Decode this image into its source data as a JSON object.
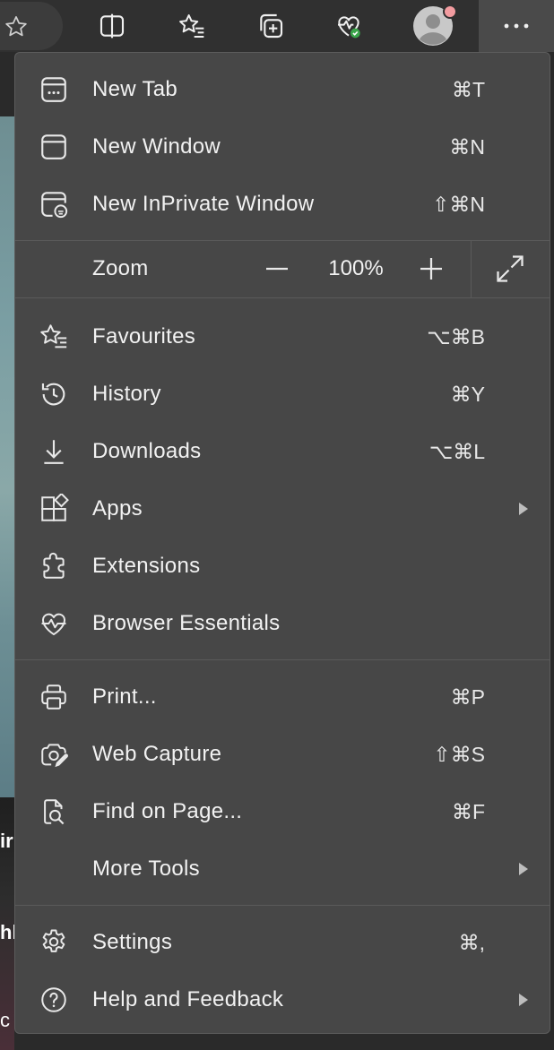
{
  "toolbar": {
    "icons": [
      "favorite-star-icon",
      "split-screen-icon",
      "favorites-icon",
      "collections-icon",
      "browser-essentials-icon",
      "profile-avatar-icon",
      "more-icon"
    ]
  },
  "background": {
    "peek_text_1": "ir",
    "peek_text_2": "hl",
    "peek_text_3": "c"
  },
  "menu": {
    "items": [
      {
        "label": "New Tab",
        "shortcut": "⌘T",
        "icon": "new-tab-icon"
      },
      {
        "label": "New Window",
        "shortcut": "⌘N",
        "icon": "new-window-icon"
      },
      {
        "label": "New InPrivate Window",
        "shortcut": "⇧⌘N",
        "icon": "inprivate-icon"
      },
      {
        "label": "Favourites",
        "shortcut": "⌥⌘B",
        "icon": "favourites-icon"
      },
      {
        "label": "History",
        "shortcut": "⌘Y",
        "icon": "history-icon"
      },
      {
        "label": "Downloads",
        "shortcut": "⌥⌘L",
        "icon": "download-icon"
      },
      {
        "label": "Apps",
        "shortcut": "",
        "icon": "apps-icon",
        "submenu": true
      },
      {
        "label": "Extensions",
        "shortcut": "",
        "icon": "extensions-icon"
      },
      {
        "label": "Browser Essentials",
        "shortcut": "",
        "icon": "heart-pulse-icon"
      },
      {
        "label": "Print...",
        "shortcut": "⌘P",
        "icon": "print-icon"
      },
      {
        "label": "Web Capture",
        "shortcut": "⇧⌘S",
        "icon": "web-capture-icon"
      },
      {
        "label": "Find on Page...",
        "shortcut": "⌘F",
        "icon": "find-on-page-icon"
      },
      {
        "label": "More Tools",
        "shortcut": "",
        "icon": "",
        "submenu": true
      },
      {
        "label": "Settings",
        "shortcut": "⌘,",
        "icon": "settings-gear-icon"
      },
      {
        "label": "Help and Feedback",
        "shortcut": "",
        "icon": "help-icon",
        "submenu": true
      }
    ],
    "zoom": {
      "label": "Zoom",
      "value": "100%"
    }
  },
  "colors": {
    "menu_bg": "#474747",
    "toolbar_bg": "#303030",
    "text": "#f2f2f2",
    "status_green": "#3aa54a",
    "notification_dot": "#f29ca0"
  }
}
